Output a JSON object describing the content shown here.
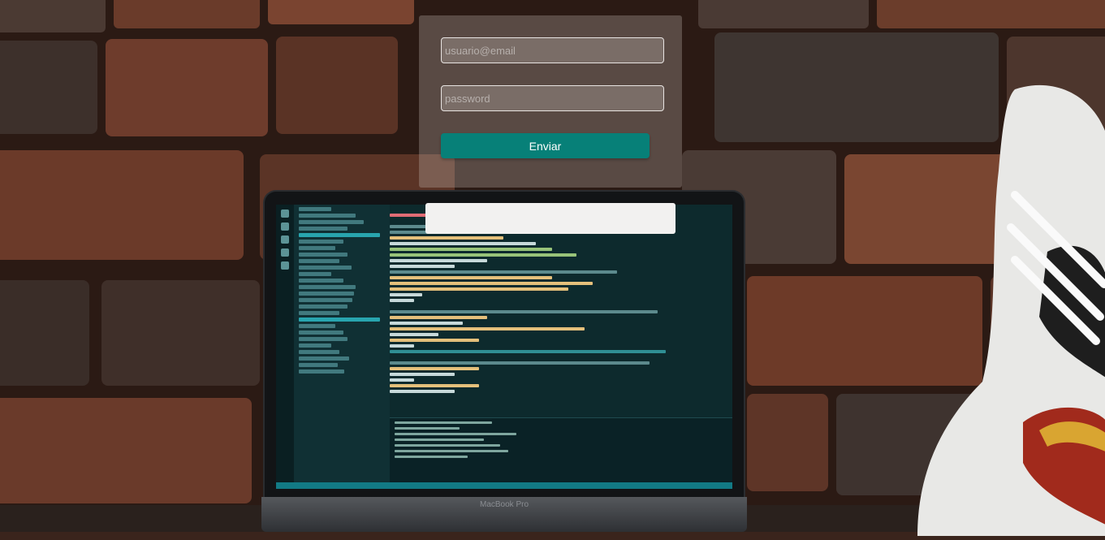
{
  "login": {
    "username_placeholder": "usuario@email",
    "password_placeholder": "password",
    "submit_label": "Enviar"
  },
  "message_box": {
    "text": ""
  },
  "laptop": {
    "brand": "MacBook Pro"
  }
}
